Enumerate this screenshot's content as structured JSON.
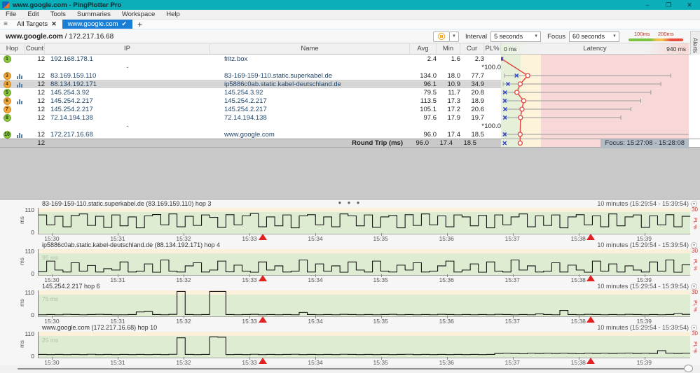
{
  "window": {
    "title": "www.google.com - PingPlotter Pro",
    "controls": {
      "minimize": "–",
      "maximize": "❐",
      "close": "✕"
    }
  },
  "menu": {
    "items": [
      "File",
      "Edit",
      "Tools",
      "Summaries",
      "Workspace",
      "Help"
    ]
  },
  "tabs": {
    "all_targets": "All Targets",
    "all_targets_close": "✕",
    "active": "www.google.com",
    "active_check": "✔",
    "new_tab": "+"
  },
  "header": {
    "target_name": "www.google.com",
    "separator": " / ",
    "target_ip": "172.217.16.68",
    "interval_label": "Interval",
    "interval_value": "5 seconds",
    "focus_label": "Focus",
    "focus_value": "60 seconds",
    "legend": {
      "label_100": "100ms",
      "label_200": "200ms"
    }
  },
  "alerts_tab": "Alerts",
  "table": {
    "headers": {
      "hop": "Hop",
      "count": "Count",
      "ip": "IP",
      "name": "Name",
      "avg": "Avg",
      "min": "Min",
      "cur": "Cur",
      "pl": "PL%"
    },
    "latency_header": {
      "left": "0 ms",
      "title": "Latency",
      "right": "940 ms"
    }
  },
  "colors": {
    "titlebar_teal": "#0aafb9",
    "tab_blue": "#1a7fd4",
    "zone_green": "#e6f0d9",
    "zone_yellow": "#fdf3da",
    "zone_red": "#f8d8d6",
    "avg_line_red": "#e0443e",
    "current_mark_blue": "#2b3fd4",
    "loss_marker_red": "#e02222",
    "hop_badge_green": "#8bc63e",
    "hop_badge_orange": "#f4a83a"
  },
  "chart_data": [
    {
      "type": "table",
      "name": "trace-hop-latency",
      "xlim_ms": [
        0,
        940
      ],
      "zones_ms": {
        "green": [
          0,
          100
        ],
        "yellow": [
          100,
          200
        ],
        "red": [
          200,
          940
        ]
      },
      "rows": [
        {
          "hop": "1",
          "badge": "green",
          "graph_icon": false,
          "count": "12",
          "ip": "192.168.178.1",
          "name": "fritz.box",
          "avg": "2.4",
          "min": "1.6",
          "cur": "2.3",
          "pl": "",
          "max_est_ms": 3,
          "selected": false
        },
        {
          "hop": "",
          "badge": "",
          "graph_icon": false,
          "count": "",
          "ip": "-",
          "name": "",
          "avg": "",
          "min": "",
          "cur": "*",
          "pl": "100.0",
          "max_est_ms": null,
          "selected": false
        },
        {
          "hop": "3",
          "badge": "orange",
          "graph_icon": true,
          "count": "12",
          "ip": "83.169.159.110",
          "name": "83-169-159-110.static.superkabel.de",
          "avg": "134.0",
          "min": "18.0",
          "cur": "77.7",
          "pl": "",
          "max_est_ms": 850,
          "selected": false
        },
        {
          "hop": "4",
          "badge": "orange",
          "graph_icon": true,
          "count": "12",
          "ip": "88.134.192.171",
          "name": "ip5886c0ab.static.kabel-deutschland.de",
          "avg": "96.1",
          "min": "10.9",
          "cur": "34.9",
          "pl": "",
          "max_est_ms": 800,
          "selected": true
        },
        {
          "hop": "5",
          "badge": "green",
          "graph_icon": false,
          "count": "12",
          "ip": "145.254.3.92",
          "name": "145.254.3.92",
          "avg": "79.5",
          "min": "11.7",
          "cur": "20.8",
          "pl": "",
          "max_est_ms": 750,
          "selected": false
        },
        {
          "hop": "6",
          "badge": "orange",
          "graph_icon": true,
          "count": "12",
          "ip": "145.254.2.217",
          "name": "145.254.2.217",
          "avg": "113.5",
          "min": "17.3",
          "cur": "18.9",
          "pl": "",
          "max_est_ms": 700,
          "selected": false
        },
        {
          "hop": "7",
          "badge": "orange",
          "graph_icon": false,
          "count": "12",
          "ip": "145.254.2.217",
          "name": "145.254.2.217",
          "avg": "105.1",
          "min": "17.2",
          "cur": "20.6",
          "pl": "",
          "max_est_ms": 650,
          "selected": false
        },
        {
          "hop": "8",
          "badge": "green",
          "graph_icon": false,
          "count": "12",
          "ip": "72.14.194.138",
          "name": "72.14.194.138",
          "avg": "97.6",
          "min": "17.9",
          "cur": "19.7",
          "pl": "",
          "max_est_ms": 600,
          "selected": false
        },
        {
          "hop": "",
          "badge": "",
          "graph_icon": false,
          "count": "",
          "ip": "-",
          "name": "",
          "avg": "",
          "min": "",
          "cur": "*",
          "pl": "100.0",
          "max_est_ms": null,
          "selected": false
        },
        {
          "hop": "10",
          "badge": "green",
          "graph_icon": true,
          "count": "12",
          "ip": "172.217.16.68",
          "name": "www.google.com",
          "avg": "96.0",
          "min": "17.4",
          "cur": "18.5",
          "pl": "",
          "max_est_ms": 940,
          "selected": false
        }
      ],
      "summary": {
        "count": "12",
        "label": "Round Trip (ms)",
        "avg": "96.0",
        "min": "17.4",
        "cur": "18.5",
        "focus": "Focus: 15:27:08 - 15:28:08"
      }
    },
    {
      "type": "step-line",
      "title": "83-169-159-110.static.superkabel.de (83.169.159.110) hop 3",
      "period_label": "10 minutes (15:29:54 - 15:39:54)",
      "ylabel": "ms",
      "ylim": [
        0,
        110
      ],
      "ytick_top": "110",
      "ytick_bottom": "0",
      "right_axis": {
        "tick": "30",
        "label": "PL %"
      },
      "x_ticks": [
        "15:30",
        "15:31",
        "15:32",
        "15:33",
        "15:34",
        "15:35",
        "15:36",
        "15:37",
        "15:38",
        "15:39"
      ],
      "x_tick_fractions": [
        0.01,
        0.111,
        0.212,
        0.313,
        0.414,
        0.514,
        0.615,
        0.716,
        0.817,
        0.918
      ],
      "loss_marker_fractions": [
        0.345,
        0.848
      ],
      "faint_label": "",
      "values": [
        95,
        45,
        88,
        35,
        92,
        100,
        42,
        88,
        32,
        95,
        40,
        85,
        30,
        90,
        97,
        45,
        100,
        35,
        88,
        42,
        95,
        83,
        32,
        96,
        45,
        90,
        102,
        35,
        85,
        40,
        95,
        30,
        90,
        96,
        45,
        85,
        35,
        100,
        90,
        40,
        95,
        33,
        85,
        92,
        30,
        96,
        42,
        100,
        45,
        90,
        35,
        95,
        85,
        40,
        92,
        30,
        95,
        45,
        85,
        100,
        35,
        90,
        42,
        95,
        30,
        85,
        96,
        45,
        90,
        35,
        100,
        40,
        85,
        95,
        32,
        90,
        45,
        96,
        35,
        88
      ]
    },
    {
      "type": "step-line",
      "title": "ip5886c0ab.static.kabel-deutschland.de (88.134.192.171) hop 4",
      "period_label": "10 minutes (15:29:54 - 15:39:54)",
      "ylabel": "ms",
      "ylim": [
        0,
        110
      ],
      "ytick_top": "110",
      "ytick_bottom": "0",
      "right_axis": {
        "tick": "30",
        "label": "PL %"
      },
      "x_ticks": [
        "15:30",
        "15:31",
        "15:32",
        "15:33",
        "15:34",
        "15:35",
        "15:36",
        "15:37",
        "15:38",
        "15:39"
      ],
      "x_tick_fractions": [
        0.01,
        0.111,
        0.212,
        0.313,
        0.414,
        0.514,
        0.615,
        0.716,
        0.817,
        0.918
      ],
      "loss_marker_fractions": [
        0.345,
        0.848
      ],
      "faint_label": "95 ms",
      "values": [
        18,
        70,
        25,
        15,
        62,
        20,
        48,
        15,
        32,
        25,
        66,
        15,
        20,
        56,
        14,
        76,
        20,
        15,
        46,
        62,
        15,
        25,
        70,
        16,
        50,
        20,
        14,
        66,
        25,
        46,
        15,
        20,
        76,
        15,
        56,
        20,
        46,
        14,
        66,
        25,
        15,
        70,
        20,
        15,
        50,
        25,
        62,
        15,
        20,
        46,
        70,
        15,
        25,
        56,
        14,
        66,
        20,
        15,
        76,
        25,
        46,
        15,
        20,
        62,
        15,
        50,
        25,
        14,
        70,
        20,
        56,
        15,
        46,
        25,
        15,
        66,
        20,
        76,
        14,
        52
      ]
    },
    {
      "type": "step-line",
      "title": "145.254.2.217 hop 6",
      "period_label": "10 minutes (15:29:54 - 15:39:54)",
      "ylabel": "ms",
      "ylim": [
        0,
        110
      ],
      "ytick_top": "110",
      "ytick_bottom": "0",
      "right_axis": {
        "tick": "30",
        "label": "PL %"
      },
      "x_ticks": [
        "15:30",
        "15:31",
        "15:32",
        "15:33",
        "15:34",
        "15:35",
        "15:36",
        "15:37",
        "15:38",
        "15:39"
      ],
      "x_tick_fractions": [
        0.01,
        0.111,
        0.212,
        0.313,
        0.414,
        0.514,
        0.615,
        0.716,
        0.817,
        0.918
      ],
      "loss_marker_fractions": [
        0.345,
        0.848
      ],
      "faint_label": "75 ms",
      "values": [
        8,
        9,
        8,
        10,
        9,
        8,
        9,
        10,
        9,
        8,
        8,
        9,
        22,
        24,
        9,
        8,
        10,
        118,
        9,
        8,
        9,
        118,
        112,
        9,
        8,
        9,
        10,
        8,
        9,
        8,
        9,
        8,
        20,
        9,
        8,
        9,
        8,
        10,
        9,
        8,
        9,
        8,
        9,
        10,
        8,
        9,
        8,
        9,
        8,
        10,
        9,
        8,
        9,
        8,
        9,
        8,
        10,
        9,
        8,
        9,
        8,
        12,
        9,
        8,
        30,
        9,
        8,
        10,
        9,
        8,
        9,
        8,
        10,
        9,
        8,
        9,
        8,
        9,
        14,
        10
      ]
    },
    {
      "type": "step-line",
      "title": "www.google.com (172.217.16.68) hop 10",
      "period_label": "10 minutes (15:29:54 - 15:39:54)",
      "ylabel": "ms",
      "ylim": [
        0,
        110
      ],
      "ytick_top": "110",
      "ytick_bottom": "0",
      "right_axis": {
        "tick": "30",
        "label": "PL %"
      },
      "x_ticks": [
        "15:30",
        "15:31",
        "15:32",
        "15:33",
        "15:34",
        "15:35",
        "15:36",
        "15:37",
        "15:38",
        "15:39"
      ],
      "x_tick_fractions": [
        0.01,
        0.111,
        0.212,
        0.313,
        0.414,
        0.514,
        0.615,
        0.716,
        0.817,
        0.918
      ],
      "loss_marker_fractions": [
        0.345,
        0.848
      ],
      "faint_label": "25 ms",
      "values": [
        16,
        15,
        16,
        15,
        16,
        15,
        17,
        15,
        16,
        15,
        16,
        15,
        16,
        15,
        16,
        15,
        17,
        100,
        16,
        15,
        16,
        105,
        103,
        15,
        16,
        15,
        17,
        15,
        16,
        15,
        16,
        17,
        15,
        16,
        15,
        16,
        15,
        17,
        16,
        15,
        16,
        15,
        16,
        15,
        16,
        17,
        15,
        16,
        15,
        16,
        15,
        16,
        15,
        16,
        15,
        16,
        21,
        22,
        21,
        20,
        22,
        21,
        22,
        21,
        22,
        21,
        20,
        22,
        21,
        22,
        21,
        22,
        23,
        21,
        22,
        21,
        35,
        22,
        21,
        22
      ]
    }
  ]
}
